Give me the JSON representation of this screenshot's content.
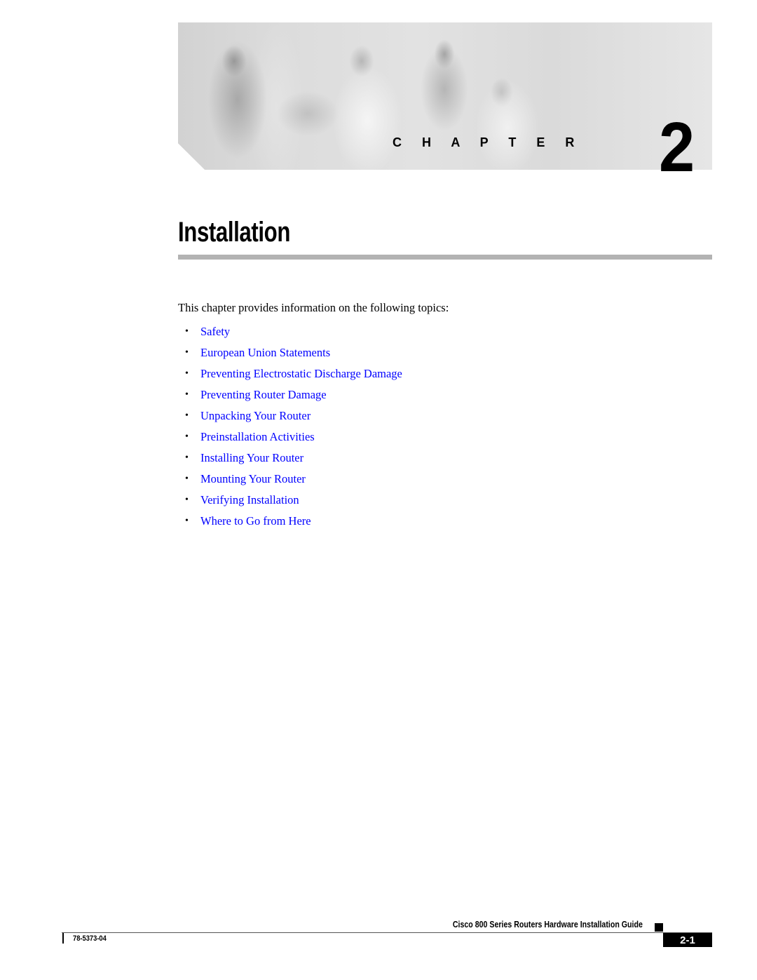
{
  "banner": {
    "photo_description": "four people working with networking equipment and a laptop",
    "chapter_word": "C H A P T E R",
    "chapter_number": "2"
  },
  "title": "Installation",
  "intro": "This chapter provides information on the following topics:",
  "link_color": "#0000ff",
  "topics": [
    {
      "bullet": "•",
      "label": "Safety"
    },
    {
      "bullet": "•",
      "label": "European Union Statements"
    },
    {
      "bullet": "•",
      "label": "Preventing Electrostatic Discharge Damage"
    },
    {
      "bullet": "•",
      "label": "Preventing Router Damage"
    },
    {
      "bullet": "•",
      "label": "Unpacking Your Router"
    },
    {
      "bullet": "•",
      "label": "Preinstallation Activities"
    },
    {
      "bullet": "•",
      "label": "Installing Your Router"
    },
    {
      "bullet": "•",
      "label": "Mounting Your Router"
    },
    {
      "bullet": "•",
      "label": "Verifying Installation"
    },
    {
      "bullet": "•",
      "label": "Where to Go from Here"
    }
  ],
  "footer": {
    "guide_title": "Cisco 800 Series Routers Hardware Installation Guide",
    "doc_number": "78-5373-04",
    "page_number": "2-1"
  }
}
